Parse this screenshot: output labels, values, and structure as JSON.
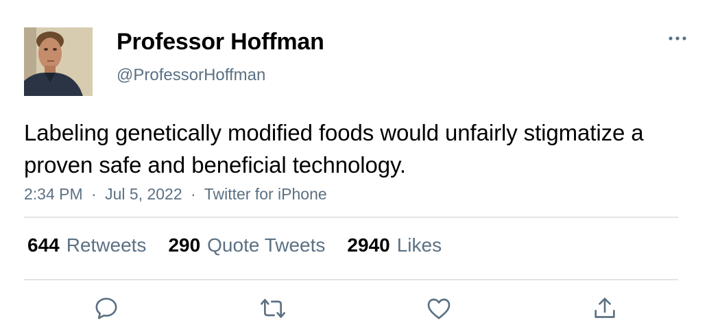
{
  "user": {
    "display_name": "Professor Hoffman",
    "handle": "@ProfessorHoffman"
  },
  "tweet": {
    "text": "Labeling genetically modified foods would unfairly stigmatize a proven safe and beneficial technology.",
    "time": "2:34 PM",
    "date": "Jul 5, 2022",
    "source": "Twitter for iPhone",
    "separator": "·"
  },
  "stats": {
    "retweets_count": "644",
    "retweets_label": "Retweets",
    "quotes_count": "290",
    "quotes_label": "Quote Tweets",
    "likes_count": "2940",
    "likes_label": "Likes"
  },
  "icons": {
    "more": "more-horizontal-icon",
    "reply": "reply-icon",
    "retweet": "retweet-icon",
    "like": "heart-icon",
    "share": "share-icon"
  },
  "colors": {
    "secondary_text": "#5b7083",
    "primary_text": "#000000",
    "divider": "#e1e5e8"
  }
}
